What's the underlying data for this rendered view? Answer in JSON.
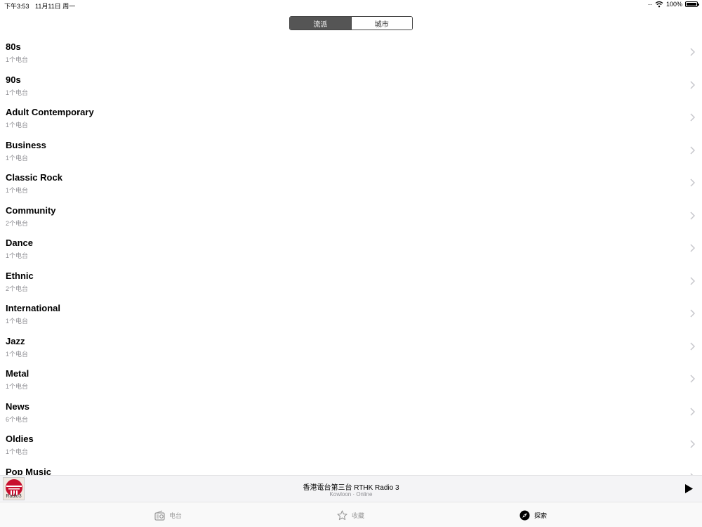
{
  "status_bar": {
    "time": "下午3:53",
    "date": "11月11日 周一",
    "battery": "100%"
  },
  "segmented_control": {
    "tabs": [
      {
        "label": "流派",
        "active": true
      },
      {
        "label": "城市",
        "active": false
      }
    ]
  },
  "genres": [
    {
      "name": "80s",
      "count": "1个电台"
    },
    {
      "name": "90s",
      "count": "1个电台"
    },
    {
      "name": "Adult Contemporary",
      "count": "1个电台"
    },
    {
      "name": "Business",
      "count": "1个电台"
    },
    {
      "name": "Classic Rock",
      "count": "1个电台"
    },
    {
      "name": "Community",
      "count": "2个电台"
    },
    {
      "name": "Dance",
      "count": "1个电台"
    },
    {
      "name": "Ethnic",
      "count": "2个电台"
    },
    {
      "name": "International",
      "count": "1个电台"
    },
    {
      "name": "Jazz",
      "count": "1个电台"
    },
    {
      "name": "Metal",
      "count": "1个电台"
    },
    {
      "name": "News",
      "count": "6个电台"
    },
    {
      "name": "Oldies",
      "count": "1个电台"
    },
    {
      "name": "Pop Music",
      "count": ""
    }
  ],
  "now_playing": {
    "title": "香港電台第三台 RTHK Radio 3",
    "subtitle": "Kowloon · Online",
    "logo_text": "Radio3"
  },
  "tab_bar": {
    "items": [
      {
        "label": "电台",
        "icon": "radio-icon",
        "active": false
      },
      {
        "label": "收藏",
        "icon": "star-icon",
        "active": false
      },
      {
        "label": "探索",
        "icon": "compass-icon",
        "active": true
      }
    ]
  },
  "colors": {
    "segment_active": "#555555",
    "secondary_text": "#8e8e93",
    "logo_red": "#c8102e"
  }
}
